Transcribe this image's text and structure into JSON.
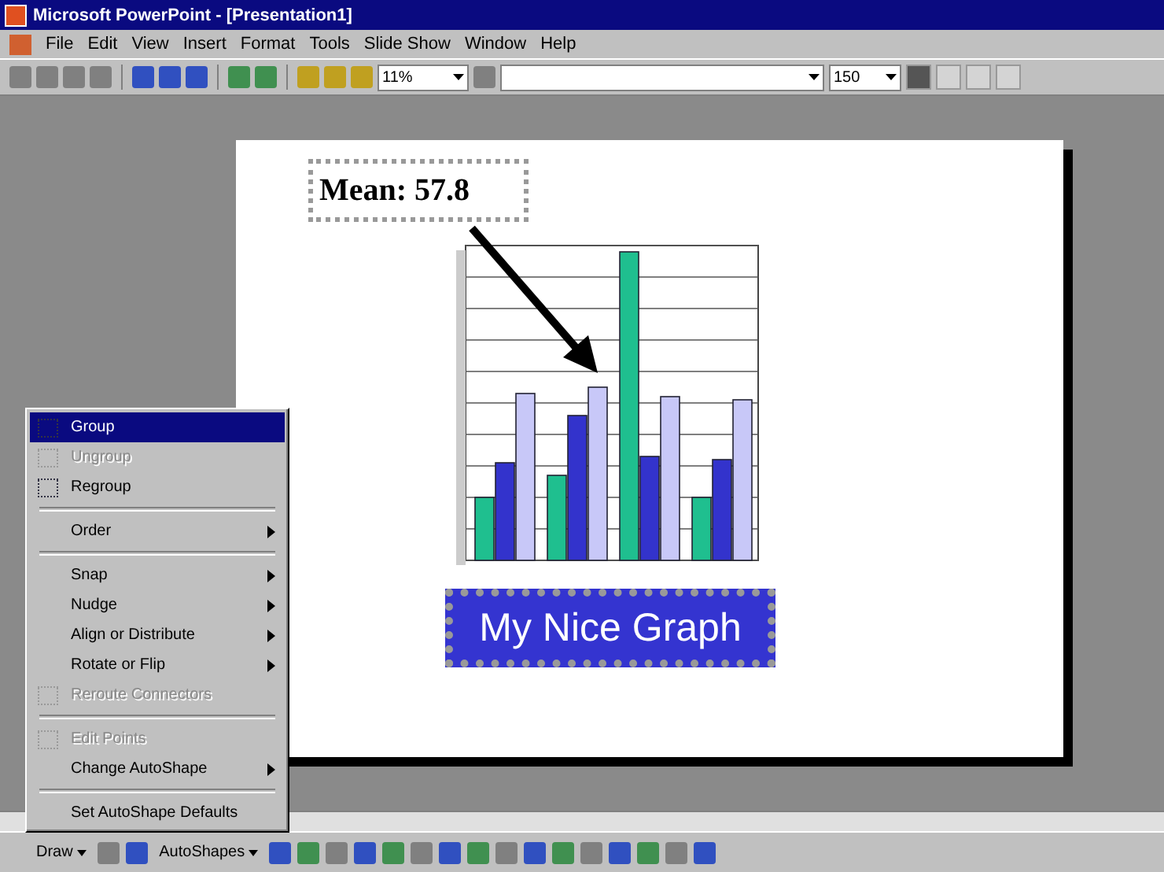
{
  "window": {
    "title": "Microsoft PowerPoint - [Presentation1]"
  },
  "menu_bar": [
    "File",
    "Edit",
    "View",
    "Insert",
    "Format",
    "Tools",
    "Slide Show",
    "Window",
    "Help"
  ],
  "toolbar": {
    "zoom": "11%",
    "font_size": "150"
  },
  "slide": {
    "mean_label": "Mean: 57.8",
    "graph_title": "My Nice Graph"
  },
  "context_menu": [
    {
      "kind": "item",
      "label": "Group",
      "selected": true,
      "disabled": false,
      "submenu": false,
      "icon": true
    },
    {
      "kind": "item",
      "label": "Ungroup",
      "selected": false,
      "disabled": true,
      "submenu": false,
      "icon": true
    },
    {
      "kind": "item",
      "label": "Regroup",
      "selected": false,
      "disabled": false,
      "submenu": false,
      "icon": true
    },
    {
      "kind": "separator"
    },
    {
      "kind": "item",
      "label": "Order",
      "selected": false,
      "disabled": false,
      "submenu": true,
      "icon": false
    },
    {
      "kind": "separator"
    },
    {
      "kind": "item",
      "label": "Snap",
      "selected": false,
      "disabled": false,
      "submenu": true,
      "icon": false
    },
    {
      "kind": "item",
      "label": "Nudge",
      "selected": false,
      "disabled": false,
      "submenu": true,
      "icon": false
    },
    {
      "kind": "item",
      "label": "Align or Distribute",
      "selected": false,
      "disabled": false,
      "submenu": true,
      "icon": false
    },
    {
      "kind": "item",
      "label": "Rotate or Flip",
      "selected": false,
      "disabled": false,
      "submenu": true,
      "icon": false
    },
    {
      "kind": "item",
      "label": "Reroute Connectors",
      "selected": false,
      "disabled": true,
      "submenu": false,
      "icon": true
    },
    {
      "kind": "separator"
    },
    {
      "kind": "item",
      "label": "Edit Points",
      "selected": false,
      "disabled": true,
      "submenu": false,
      "icon": true
    },
    {
      "kind": "item",
      "label": "Change AutoShape",
      "selected": false,
      "disabled": false,
      "submenu": true,
      "icon": false
    },
    {
      "kind": "separator"
    },
    {
      "kind": "item",
      "label": "Set AutoShape Defaults",
      "selected": false,
      "disabled": false,
      "submenu": false,
      "icon": false
    }
  ],
  "draw_toolbar": {
    "draw": "Draw",
    "autoshapes": "AutoShapes"
  }
}
